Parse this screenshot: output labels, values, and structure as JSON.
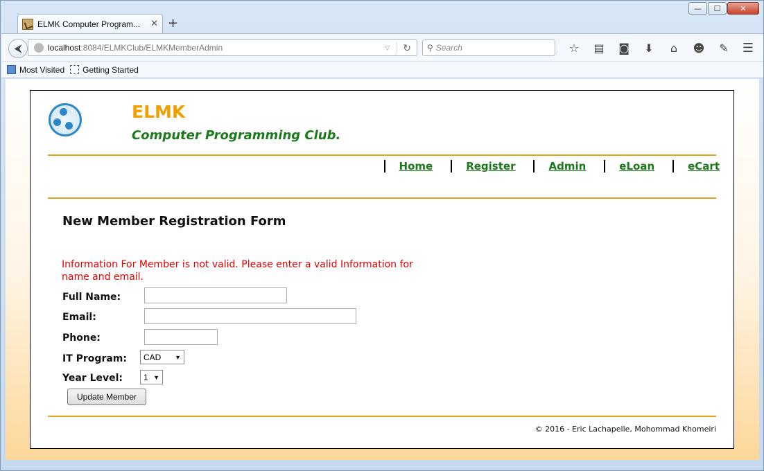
{
  "browser": {
    "tab_title": "ELMK Computer Program...",
    "tab_close": "✕",
    "new_tab": "+",
    "url_host": "localhost",
    "url_path": ":8084/ELMKClub/ELMKMemberAdmin",
    "search_placeholder": "Search",
    "bookmarks": [
      "Most Visited",
      "Getting Started"
    ],
    "window_controls": {
      "minimize": "—",
      "maximize": "☐",
      "close": "✕"
    }
  },
  "site": {
    "title": "ELMK",
    "subtitle": "Computer Programming Club.",
    "nav": [
      "Home",
      "Register",
      "Admin",
      "eLoan",
      "eCart"
    ],
    "colors": {
      "title": "#f0a000",
      "subtitle": "#1a7a1a",
      "rule": "#e6a21a",
      "error": "#e00000"
    }
  },
  "form": {
    "title": "New Member Registration Form",
    "error": "Information For Member is not valid. Please enter a valid Information for name and email.",
    "labels": {
      "full_name": "Full Name:",
      "email": "Email:",
      "phone": "Phone:",
      "it_program": "IT Program:",
      "year_level": "Year Level:"
    },
    "values": {
      "full_name": "",
      "email": "",
      "phone": ""
    },
    "it_program_selected": "CAD",
    "year_level_selected": "1",
    "submit_label": "Update Member"
  },
  "footer": {
    "text": "© 2016 - Eric Lachapelle, Mohommad Khomeiri"
  }
}
